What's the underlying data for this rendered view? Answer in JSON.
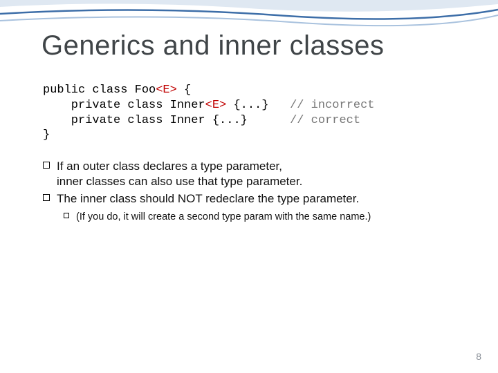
{
  "title": "Generics and inner classes",
  "code": {
    "l1_a": "public class Foo",
    "l1_b": "<E>",
    "l1_c": " {",
    "l2_a": "    private class Inner",
    "l2_b": "<E>",
    "l2_c": " {...}   ",
    "l2_d": "// incorrect",
    "l3_a": "    private class Inner {...}      ",
    "l3_b": "// correct",
    "l4": "}"
  },
  "bullets": {
    "b1_a": "If an outer class declares a type parameter,",
    "b1_b": "inner classes can also use that type parameter.",
    "b2": "The inner class should NOT redeclare the type parameter.",
    "sub": "(If you do, it will create a second type param with the same name.)"
  },
  "page": "8"
}
